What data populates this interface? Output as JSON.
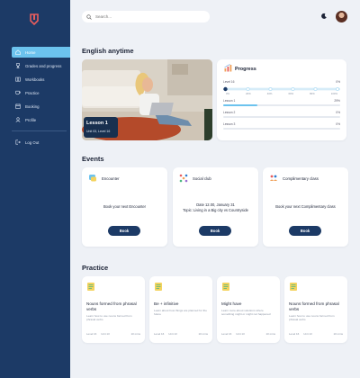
{
  "sidebar": {
    "items": [
      {
        "label": "Home",
        "icon": "home-icon",
        "active": true
      },
      {
        "label": "Grades and progress",
        "icon": "trophy-icon",
        "active": false
      },
      {
        "label": "Workbooks",
        "icon": "book-icon",
        "active": false
      },
      {
        "label": "Practice",
        "icon": "cup-icon",
        "active": false
      },
      {
        "label": "Booking",
        "icon": "calendar-icon",
        "active": false
      },
      {
        "label": "Profile",
        "icon": "user-icon",
        "active": false
      }
    ],
    "logout_label": "Log Out",
    "accent_color": "#6cc3ee",
    "background_color": "#1c3a66"
  },
  "header": {
    "search_placeholder": "Search..."
  },
  "home": {
    "title": "English anytime",
    "lesson": {
      "title": "Lesson 1",
      "meta": "Unit 03, Level 16"
    }
  },
  "progress": {
    "title": "Progress",
    "level_label": "Level 16",
    "level_percent": "0%",
    "level_value": 0,
    "level_ticks": [
      "0%",
      "20%",
      "40%",
      "60%",
      "80%",
      "100%"
    ],
    "lessons": [
      {
        "label": "Lesson 1",
        "percent": "29%",
        "value": 0.29
      },
      {
        "label": "Lesson 2",
        "percent": "0%",
        "value": 0
      },
      {
        "label": "Lesson 3",
        "percent": "0%",
        "value": 0
      }
    ]
  },
  "events": {
    "title": "Events",
    "button_label": "Book",
    "items": [
      {
        "title": "Encounter",
        "lines": [
          "Book your next Encounter"
        ]
      },
      {
        "title": "Social club",
        "lines": [
          "Date 12.00, January 31",
          "Topic: Living in a Big city vs Countryside"
        ]
      },
      {
        "title": "Complimentary class",
        "lines": [
          "Book your next Complimentary class"
        ]
      }
    ]
  },
  "practice": {
    "title": "Practice",
    "items": [
      {
        "title": "Nouns formed from phrasal verbs",
        "desc": "Learn how to use nouns formed from phrasal verbs",
        "level": "Level 16",
        "unit": "Unit 13",
        "duration": "10 mins"
      },
      {
        "title": "Be + infinitive",
        "desc": "Learn about how things are planned for the future",
        "level": "Level 16",
        "unit": "Unit 13",
        "duration": "10 mins"
      },
      {
        "title": "Might have",
        "desc": "Learn more about solutions where something might or might not happened",
        "level": "Level 16",
        "unit": "Unit 13",
        "duration": "10 mins"
      },
      {
        "title": "Nouns formed from phrasal verbs",
        "desc": "Learn how to use nouns formed from phrasal verbs",
        "level": "Level 16",
        "unit": "Unit 13",
        "duration": "10 mins"
      }
    ]
  }
}
